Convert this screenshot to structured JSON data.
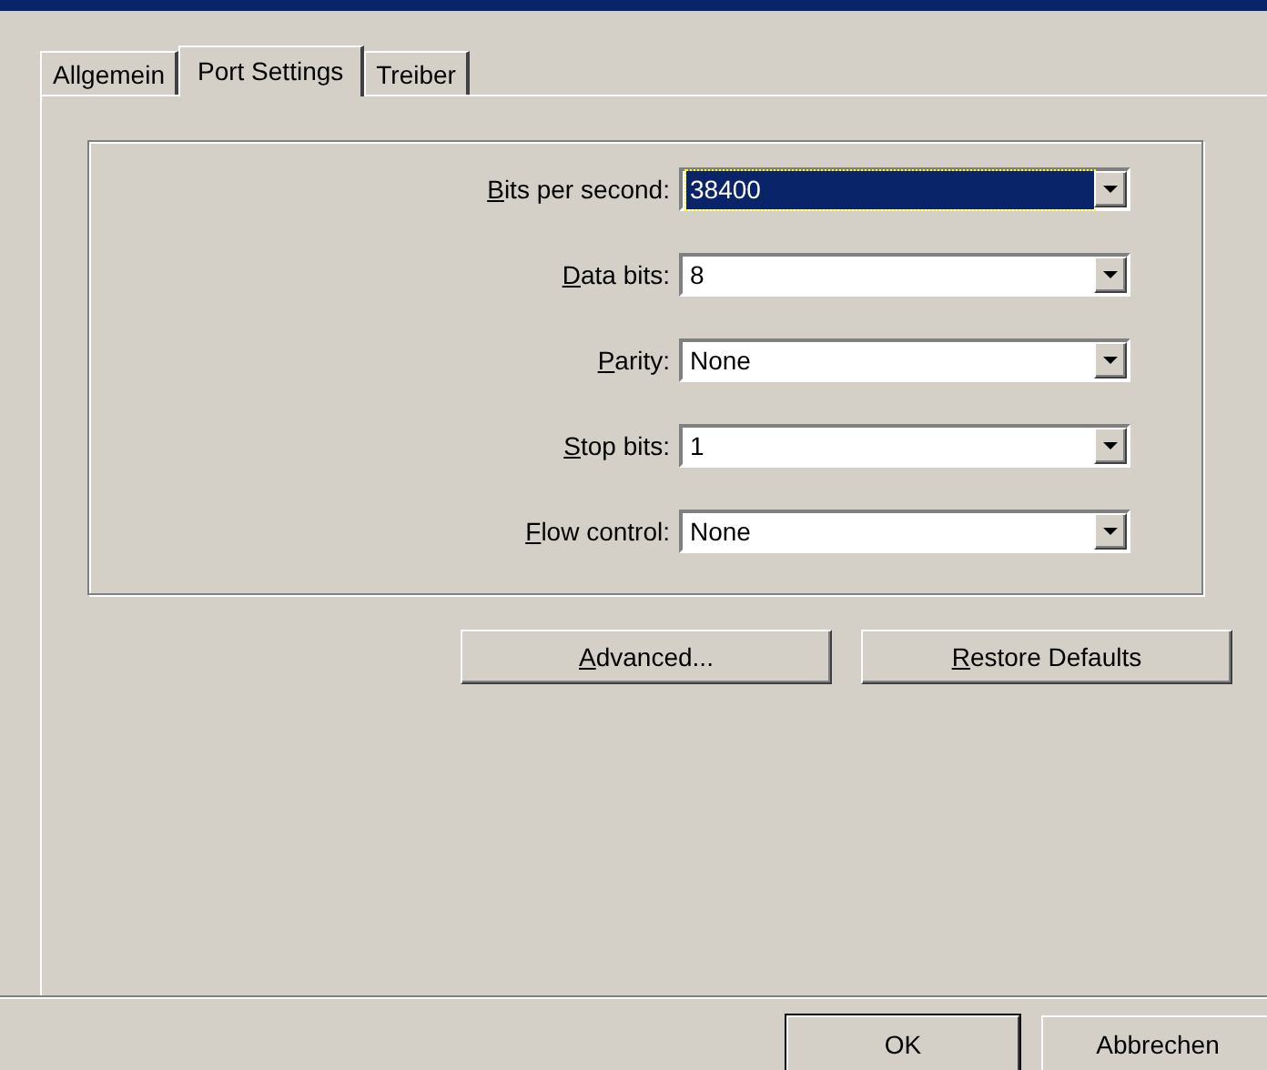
{
  "tabs": [
    {
      "label": "Allgemein",
      "selected": false
    },
    {
      "label": "Port Settings",
      "selected": true
    },
    {
      "label": "Treiber",
      "selected": false
    }
  ],
  "fields": [
    {
      "label": "Bits per second:",
      "value": "38400",
      "focused": true
    },
    {
      "label": "Data bits:",
      "value": "8",
      "focused": false
    },
    {
      "label": "Parity:",
      "value": "None",
      "focused": false
    },
    {
      "label": "Stop bits:",
      "value": "1",
      "focused": false
    },
    {
      "label": "Flow control:",
      "value": "None",
      "focused": false
    }
  ],
  "panel_buttons": [
    "Advanced...",
    "Restore Defaults"
  ],
  "dialog_buttons": [
    {
      "label": "OK",
      "default": true
    },
    {
      "label": "Abbrechen",
      "default": false
    }
  ]
}
